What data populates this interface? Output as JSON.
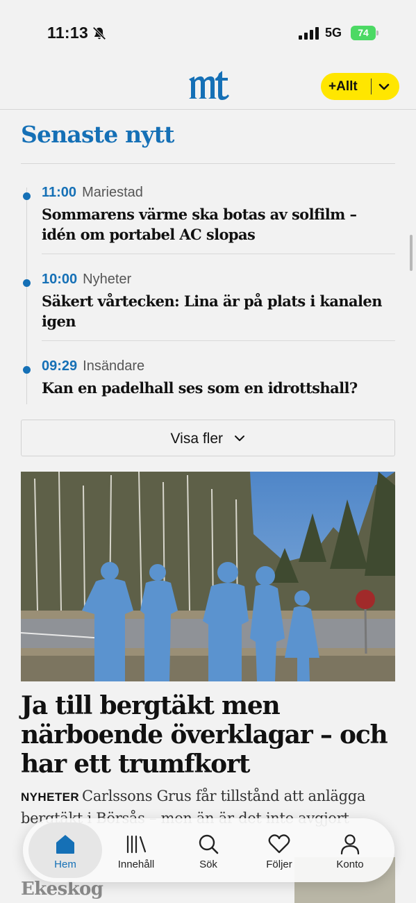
{
  "status_bar": {
    "time": "11:13",
    "network": "5G",
    "battery": "74"
  },
  "header": {
    "logo_icon": "mt-logo",
    "allt_label": "+Allt",
    "brand_color": "#1570b6",
    "accent_color": "#ffe600"
  },
  "latest": {
    "title": "Senaste nytt",
    "items": [
      {
        "time": "11:00",
        "category": "Mariestad",
        "headline": "Sommarens värme ska botas av solfilm – idén om portabel AC slopas"
      },
      {
        "time": "10:00",
        "category": "Nyheter",
        "headline": "Säkert vårtecken: Lina är på plats i kanalen igen"
      },
      {
        "time": "09:29",
        "category": "Insändare",
        "headline": "Kan en padelhall ses som en idrottshall?"
      }
    ],
    "more_label": "Visa fler"
  },
  "article": {
    "title": "Ja till bergtäkt men närboende överklagar – och har ett trumfkort",
    "tag": "NYHETER",
    "lead": "Carlssons Grus får tillstånd att anlägga bergtäkt i Börsås – men än är det inte avgjort"
  },
  "next_article": {
    "title": "Ekeskog"
  },
  "tabbar": {
    "tabs": [
      {
        "label": "Hem",
        "icon": "home-icon",
        "active": true
      },
      {
        "label": "Innehåll",
        "icon": "library-icon",
        "active": false
      },
      {
        "label": "Sök",
        "icon": "search-icon",
        "active": false
      },
      {
        "label": "Följer",
        "icon": "heart-icon",
        "active": false
      },
      {
        "label": "Konto",
        "icon": "account-icon",
        "active": false
      }
    ]
  }
}
